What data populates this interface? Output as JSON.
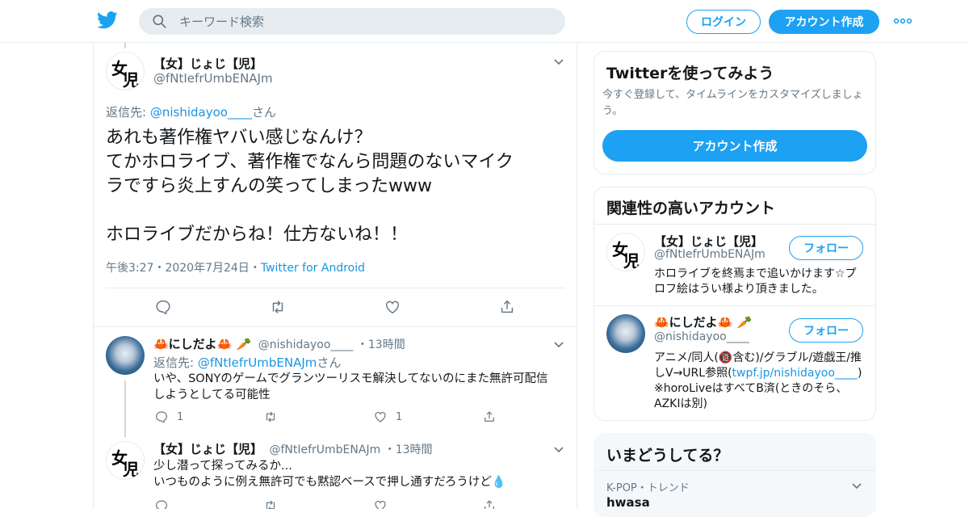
{
  "header": {
    "search_placeholder": "キーワード検索",
    "login_label": "ログイン",
    "signup_label": "アカウント作成",
    "brand_color": "#1da1f2"
  },
  "main_tweet": {
    "display_name": "【女】じょじ【児】",
    "handle": "@fNtIefrUmbENAJm",
    "avatar_text": "女児",
    "reply_to_prefix": "返信先: ",
    "reply_to_handle": "@nishidayoo____",
    "reply_to_suffix": "さん",
    "text": "あれも著作権ヤバい感じなんけ？\nてかホロライブ、著作権でなんら問題のないマイク\nラですら炎上すんの笑ってしまったwww\n\nホロライブだからね！仕方ないね！！",
    "time": "午後3:27",
    "date": "2020年7月24日",
    "source": "Twitter for Android",
    "sep": "・"
  },
  "replies": [
    {
      "display_name": "🦀にしだよ🦀 🥕",
      "handle": "@nishidayoo____",
      "time": "13時間",
      "reply_to_prefix": "返信先: ",
      "reply_to_handle": "@fNtIefrUmbENAJm",
      "reply_to_suffix": "さん",
      "text": "いや、SONYのゲームでグランツーリスモ解決してないのにまた無許可配信\nしようとしてる可能性",
      "reply_count": "1",
      "like_count": "1"
    },
    {
      "display_name": "【女】じょじ【児】",
      "handle": "@fNtIefrUmbENAJm",
      "time": "13時間",
      "text": "少し潜って探ってみるか...\nいつものように例え無許可でも黙認ベースで押し通すだろうけど💧"
    }
  ],
  "sidebar": {
    "signup_card": {
      "title": "Twitterを使ってみよう",
      "subtitle": "今すぐ登録して、タイムラインをカスタマイズしましょう。",
      "button": "アカウント作成"
    },
    "related": {
      "title": "関連性の高いアカウント",
      "follow_label": "フォロー",
      "accounts": [
        {
          "display_name": "【女】じょじ【児】",
          "handle": "@fNtIefrUmbENAJm",
          "bio": "ホロライブを終焉まで追いかけます☆プロフ絵はうい様より頂きました。"
        },
        {
          "display_name": "🦀にしだよ🦀 🥕",
          "handle": "@nishidayoo____",
          "bio_a": "アニメ/同人(🔞含む)/グラブル/遊戯王/推しV→URL参照(",
          "bio_link": "twpf.jp/nishidayoo____",
          "bio_b": ") ※horoLiveはすべてB済(ときのそら、AZKIは別)"
        }
      ]
    },
    "trends": {
      "title": "いまどうしてる？",
      "items": [
        {
          "category": "K-POP・トレンド",
          "name": "hwasa"
        }
      ]
    }
  }
}
